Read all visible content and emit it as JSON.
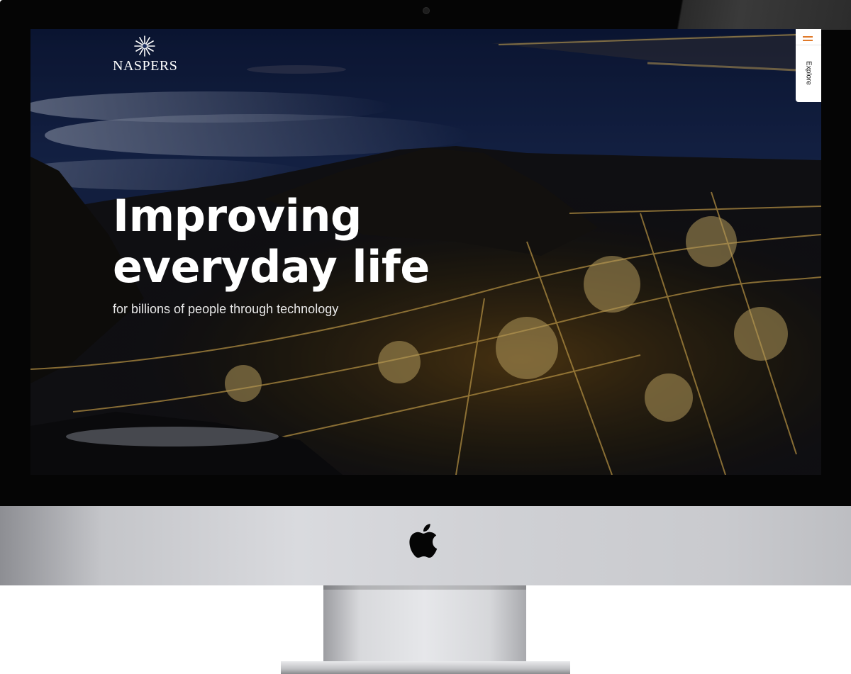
{
  "brand": {
    "name": "NASPERS"
  },
  "hero": {
    "title_line1": "Improving",
    "title_line2": "everyday life",
    "subtitle": "for billions of people through technology"
  },
  "side_tab": {
    "menu_icon": "hamburger-menu-icon",
    "label": "Explore"
  },
  "device": {
    "logo_icon": "apple-logo-icon"
  },
  "colors": {
    "accent": "#e07a2a",
    "sky": "#1a2a55",
    "city_lights": "#f2c25a",
    "bezel": "#050505"
  }
}
